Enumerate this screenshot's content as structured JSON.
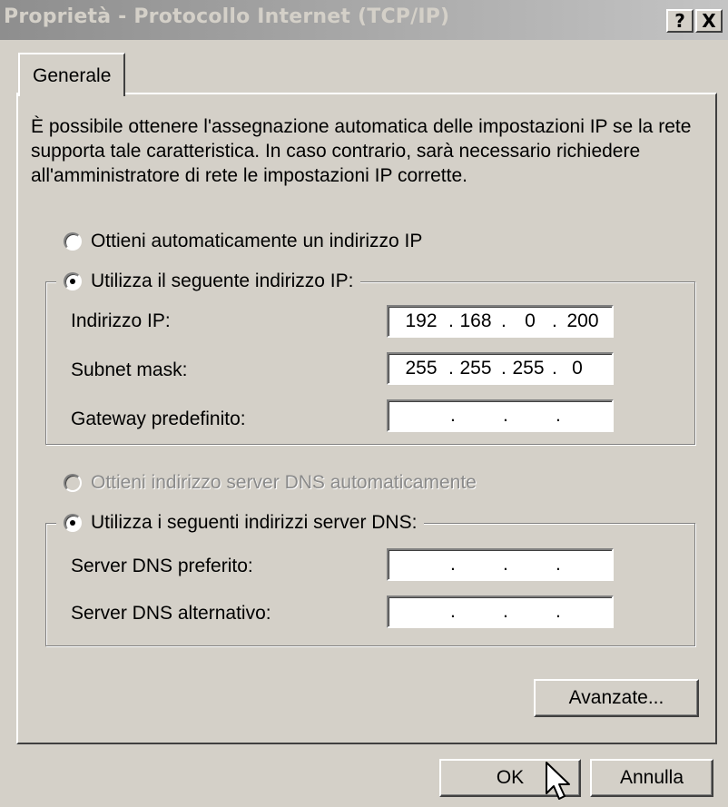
{
  "window": {
    "title": "Proprietà - Protocollo Internet (TCP/IP)",
    "help_label": "?",
    "close_label": "X"
  },
  "tabs": [
    {
      "label": "Generale"
    }
  ],
  "description": "È possibile ottenere l'assegnazione automatica delle impostazioni IP se la rete supporta tale caratteristica. In caso contrario, sarà necessario richiedere all'amministratore di rete le impostazioni IP corrette.",
  "ip_section": {
    "auto_label": "Ottieni automaticamente un indirizzo IP",
    "manual_label": "Utilizza il seguente indirizzo IP:",
    "selected": "manual",
    "fields": [
      {
        "label": "Indirizzo IP:",
        "octets": [
          "192",
          "168",
          "0",
          "200"
        ]
      },
      {
        "label": "Subnet mask:",
        "octets": [
          "255",
          "255",
          "255",
          "0"
        ]
      },
      {
        "label": "Gateway predefinito:",
        "octets": [
          "",
          "",
          "",
          ""
        ]
      }
    ]
  },
  "dns_section": {
    "auto_label": "Ottieni indirizzo server DNS automaticamente",
    "manual_label": "Utilizza i seguenti indirizzi server DNS:",
    "selected": "manual",
    "fields": [
      {
        "label": "Server DNS preferito:",
        "octets": [
          "",
          "",
          "",
          ""
        ]
      },
      {
        "label": "Server DNS alternativo:",
        "octets": [
          "",
          "",
          "",
          ""
        ]
      }
    ]
  },
  "buttons": {
    "advanced": "Avanzate...",
    "ok": "OK",
    "cancel": "Annulla"
  },
  "icons": {
    "cursor": "arrow-pointer-icon"
  }
}
